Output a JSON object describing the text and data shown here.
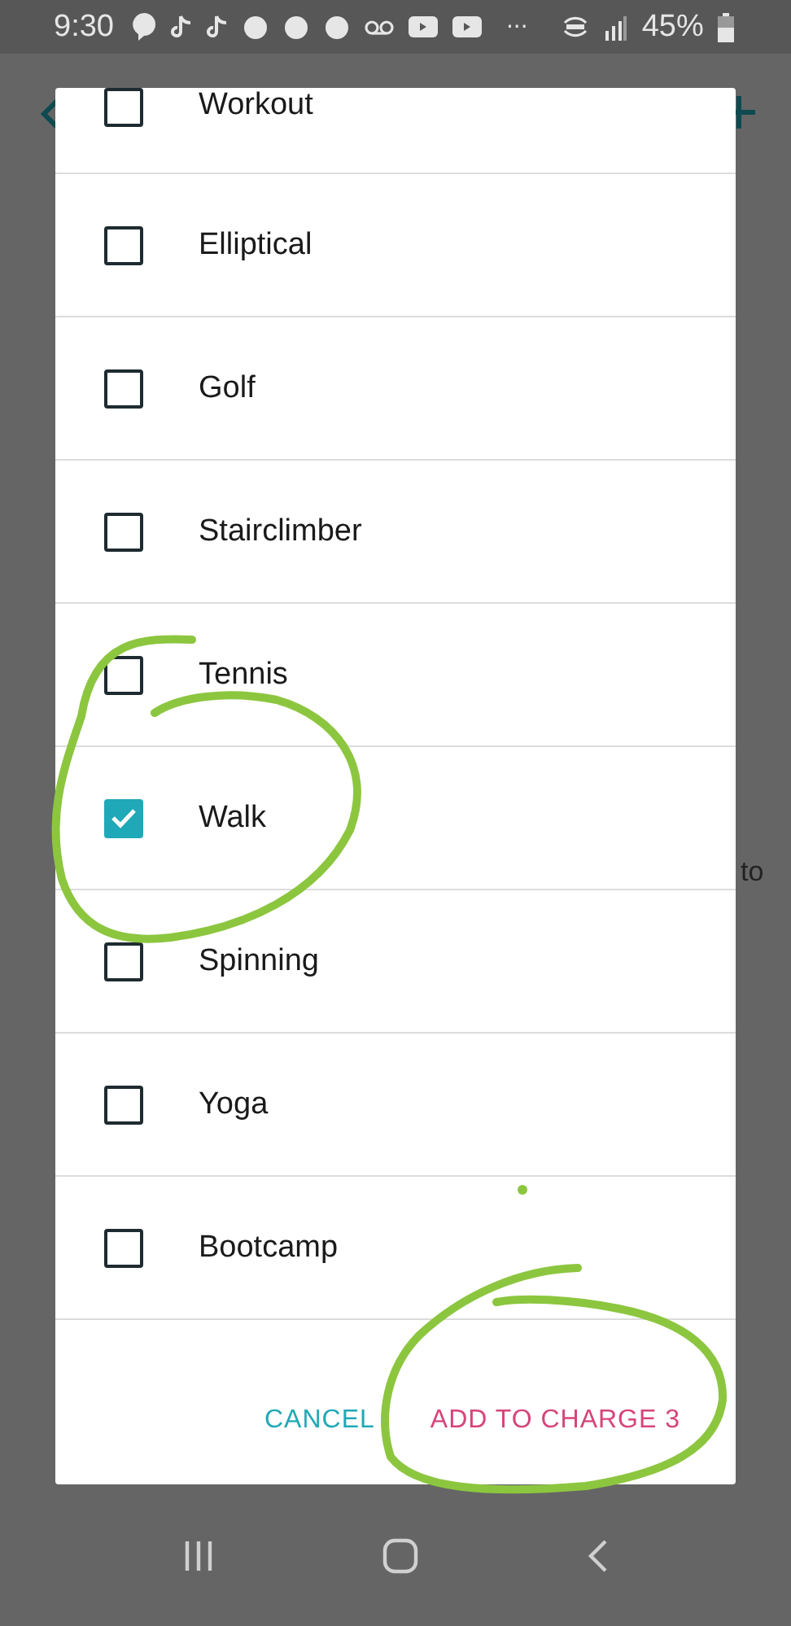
{
  "status_bar": {
    "time": "9:30",
    "more": "···",
    "battery": "45%"
  },
  "background": {
    "fragment": "to"
  },
  "dialog": {
    "items": [
      {
        "label": "Workout",
        "checked": false
      },
      {
        "label": "Elliptical",
        "checked": false
      },
      {
        "label": "Golf",
        "checked": false
      },
      {
        "label": "Stairclimber",
        "checked": false
      },
      {
        "label": "Tennis",
        "checked": false
      },
      {
        "label": "Walk",
        "checked": true
      },
      {
        "label": "Spinning",
        "checked": false
      },
      {
        "label": "Yoga",
        "checked": false
      },
      {
        "label": "Bootcamp",
        "checked": false
      }
    ],
    "buttons": [
      {
        "label": "CANCEL",
        "kind": "cancel"
      },
      {
        "label": "ADD TO CHARGE 3",
        "kind": "confirm"
      }
    ]
  }
}
